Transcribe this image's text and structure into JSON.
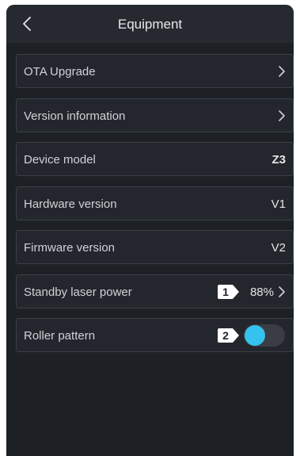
{
  "header": {
    "title": "Equipment",
    "back_icon": "chevron-left-icon"
  },
  "rows": [
    {
      "label": "OTA Upgrade",
      "type": "nav"
    },
    {
      "label": "Version information",
      "type": "nav"
    },
    {
      "label": "Device model",
      "value": "Z3"
    },
    {
      "label": "Hardware version",
      "value": "V1"
    },
    {
      "label": "Firmware version",
      "value": "V2"
    },
    {
      "label": "Standby laser power",
      "value": "88%",
      "badge": "1",
      "type": "nav"
    },
    {
      "label": "Roller pattern",
      "badge": "2",
      "toggle_on": true,
      "toggle_color": "#35c2f0"
    }
  ]
}
